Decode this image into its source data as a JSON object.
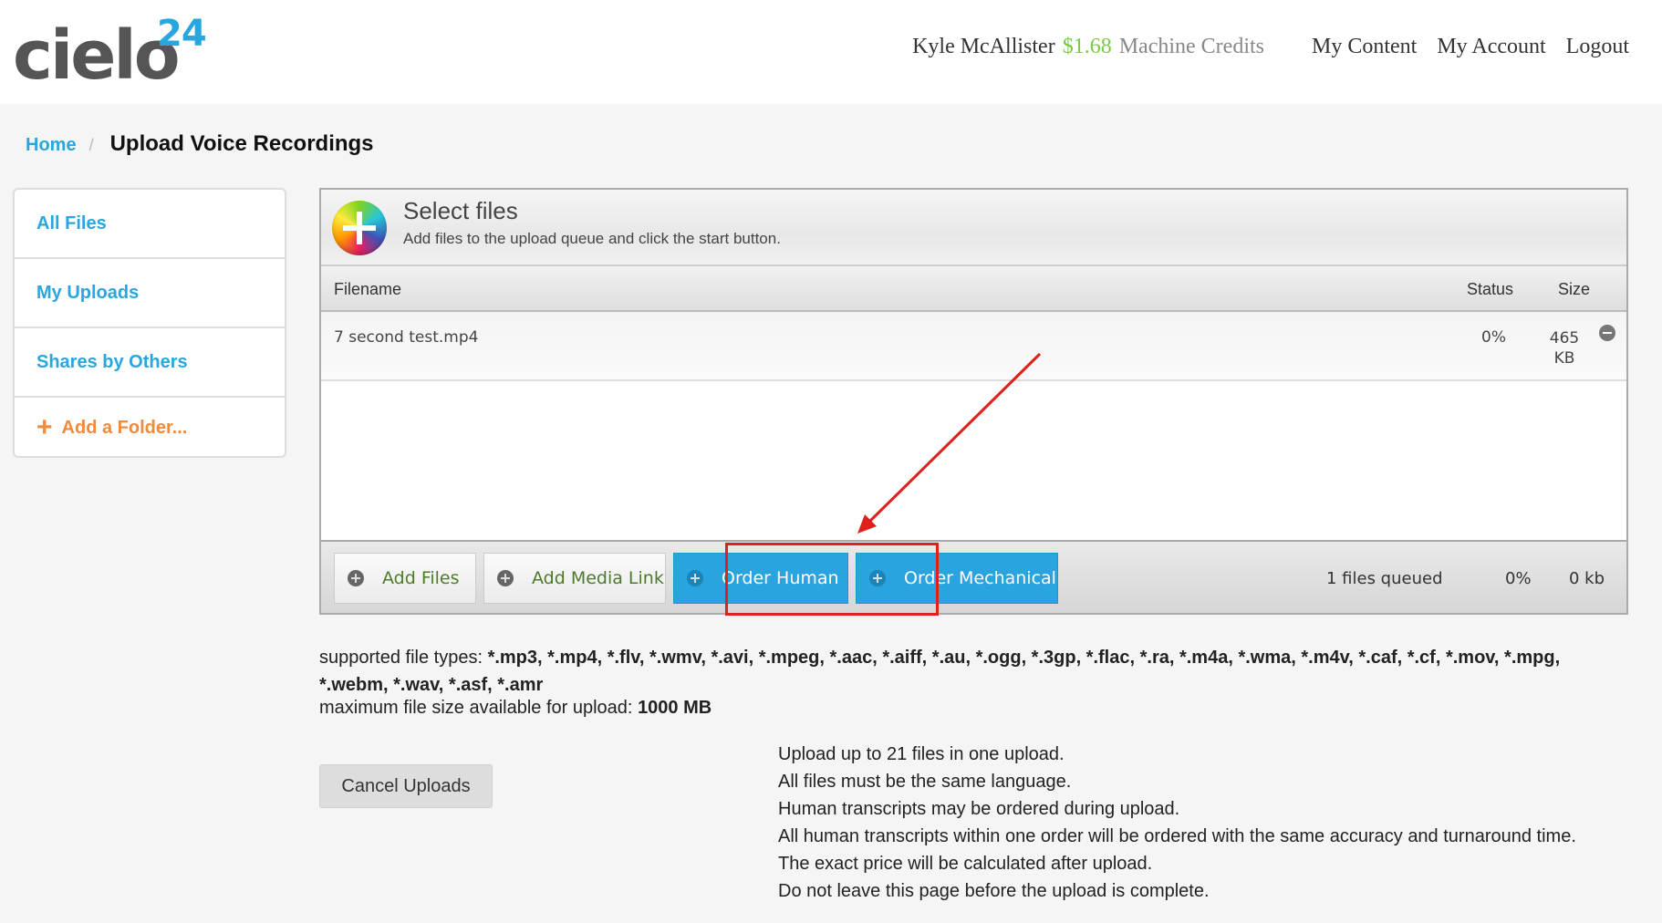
{
  "header": {
    "logo_word": "cielo",
    "logo_number": "24",
    "user_name": "Kyle McAllister",
    "credits_amount": "$1.68",
    "credits_label": "Machine Credits",
    "nav": [
      "My Content",
      "My Account",
      "Logout"
    ]
  },
  "breadcrumb": {
    "home": "Home",
    "separator": "/",
    "current": "Upload Voice Recordings"
  },
  "sidebar": {
    "items": [
      {
        "label": "All Files"
      },
      {
        "label": "My Uploads"
      },
      {
        "label": "Shares by Others"
      },
      {
        "label": "Add a Folder..."
      }
    ]
  },
  "uploader": {
    "title": "Select files",
    "subtitle": "Add files to the upload queue and click the start button.",
    "columns": {
      "filename": "Filename",
      "status": "Status",
      "size": "Size"
    },
    "files": [
      {
        "name": "7 second test.mp4",
        "status": "0%",
        "size_value": "465",
        "size_unit": "KB"
      }
    ],
    "buttons": {
      "add_files": "Add Files",
      "add_media_link": "Add Media Link",
      "order_human": "Order Human",
      "order_mechanical": "Order Mechanical"
    },
    "footer": {
      "queued": "1 files queued",
      "percent": "0%",
      "size": "0 kb"
    }
  },
  "info": {
    "types_label": "supported file types:",
    "types_value": "*.mp3, *.mp4, *.flv, *.wmv, *.avi, *.mpeg, *.aac, *.aiff, *.au, *.ogg, *.3gp, *.flac, *.ra, *.m4a, *.wma, *.m4v, *.caf, *.cf, *.mov, *.mpg, *.webm, *.wav, *.asf, *.amr",
    "max_label": "maximum file size available for upload:",
    "max_value": "1000 MB",
    "cancel_button": "Cancel Uploads",
    "notes": [
      "Upload up to 21 files in one upload.",
      "All files must be the same language.",
      "Human transcripts may be ordered during upload.",
      "All human transcripts within one order will be ordered with the same accuracy and turnaround time.",
      "The exact price will be calculated after upload.",
      "Do not leave this page before the upload is complete."
    ]
  },
  "colors": {
    "accent_blue": "#2aa4de",
    "credits_green": "#7ac943",
    "folder_orange": "#f08a3c",
    "annotation_red": "#e0201b"
  }
}
